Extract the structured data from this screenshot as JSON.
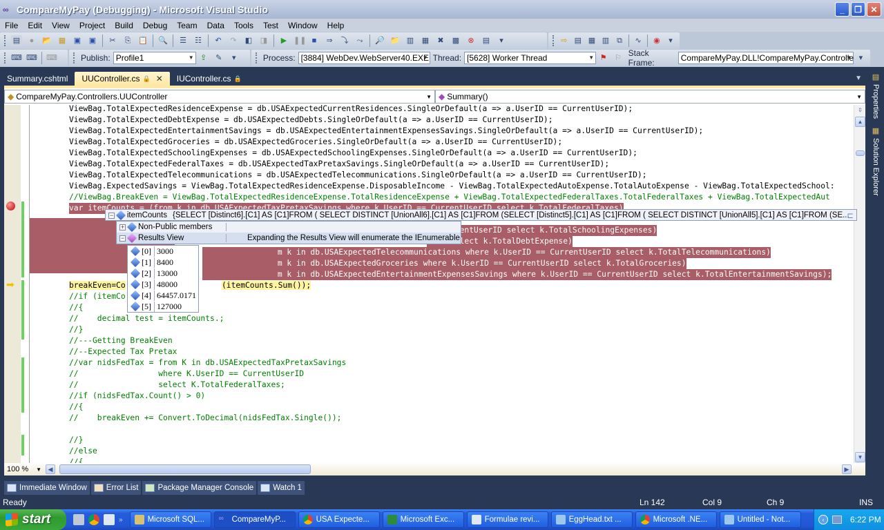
{
  "window": {
    "title": "CompareMyPay (Debugging) - Microsoft Visual Studio"
  },
  "menu": [
    "File",
    "Edit",
    "View",
    "Project",
    "Build",
    "Debug",
    "Team",
    "Data",
    "Tools",
    "Test",
    "Window",
    "Help"
  ],
  "toolbar2": {
    "publish_label": "Publish:",
    "publish_value": "Profile1",
    "process_label": "Process:",
    "process_value": "[3884] WebDev.WebServer40.EXE",
    "thread_label": "Thread:",
    "thread_value": "[5628] Worker Thread",
    "stackframe_label": "Stack Frame:",
    "stackframe_value": "CompareMyPay.DLL!CompareMyPay.Controlle"
  },
  "tabs": [
    {
      "label": "Summary.cshtml",
      "active": false
    },
    {
      "label": "UUController.cs",
      "active": true,
      "locked": true
    },
    {
      "label": "IUController.cs",
      "active": false,
      "locked": true
    }
  ],
  "navbar": {
    "type_value": "CompareMyPay.Controllers.UUController",
    "member_value": "Summary()"
  },
  "code": [
    "ViewBag.TotalExpectedResidenceExpense = db.USAExpectedCurrentResidences.SingleOrDefault(a => a.UserID == CurrentUserID);",
    "ViewBag.TotalExpectedDebtExpense = db.USAExpectedDebts.SingleOrDefault(a => a.UserID == CurrentUserID);",
    "ViewBag.TotalExpectedEntertainmentSavings = db.USAExpectedEntertainmentExpensesSavings.SingleOrDefault(a => a.UserID == CurrentUserID);",
    "ViewBag.TotalExpectedGroceries = db.USAExpectedGroceries.SingleOrDefault(a => a.UserID == CurrentUserID);",
    "ViewBag.TotalExpectedSchoolingExpenses = db.USAExpectedSchoolingExpenses.SingleOrDefault(a => a.UserID == CurrentUserID);",
    "ViewBag.TotalExpectedFederalTaxes = db.USAExpectedTaxPretaxSavings.SingleOrDefault(a => a.UserID == CurrentUserID);",
    "ViewBag.TotalExpectedTelecommunications = db.USAExpectedTelecommunications.SingleOrDefault(a => a.UserID == CurrentUserID);",
    "ViewBag.ExpectedSavings = ViewBag.TotalExpectedResidenceExpense.DisposableIncome - ViewBag.TotalExpectedAutoExpense.TotalAutoExpense - ViewBag.TotalExpectedSchool:",
    "//ViewBag.BreakEven = ViewBag.TotalExpectedResidenceExpense.TotalResidenceExpense + ViewBag.TotalExpectedFederalTaxes.TotalFederalTaxes + ViewBag.TotalExpectedAut",
    "var itemCounts = (from k in db.USAExpectedTaxPretaxSavings where k.UserID == CurrentUserID select k.TotalFederalTaxes)",
    "",
    "                                                              == CurrentUserID select k.TotalSchoolingExpenses)",
    "                                                              erID select k.TotalDebtExpense)",
    "                m k in db.USAExpectedTelecommunications where k.UserID == CurrentUserID select k.TotalTelecommunications)",
    "                m k in db.USAExpectedGroceries where k.UserID == CurrentUserID select k.TotalGroceries)",
    "                m k in db.USAExpectedEntertainmentExpensesSavings where k.UserID == CurrentUserID select k.TotalEntertainmentSavings);",
    "breakEven=Co",
    "//if (itemCo",
    "//{",
    "//    decimal test = itemCounts.;",
    "//}",
    "//---Getting BreakEven",
    "//--Expected Tax Pretax",
    "//var nidsFedTax = from K in db.USAExpectedTaxPretaxSavings",
    "//                 where K.UserID == CurrentUserID",
    "//                 select K.TotalFederalTaxes;",
    "//if (nidsFedTax.Count() > 0)",
    "//{",
    "//    breakEven += Convert.ToDecimal(nidsFedTax.Single());",
    "",
    "//}",
    "//else",
    "//{"
  ],
  "code_tail": {
    "sum_call": "(itemCounts.Sum());"
  },
  "datatip": {
    "name": "itemCounts",
    "value": "{SELECT [Distinct6].[C1] AS [C1]FROM ( SELECT DISTINCT [UnionAll6].[C1] AS [C1]FROM  (SELECT [Distinct5].[C1] AS [C1]FROM ( SELECT DISTINCT [UnionAll5].[C1] AS [C1]FROM  (SE...",
    "non_public": "Non-Public members",
    "results_view": "Results View",
    "results_note": "Expanding the Results View will enumerate the IEnumerable",
    "items": [
      {
        "index": "[0]",
        "value": "3000"
      },
      {
        "index": "[1]",
        "value": "8400"
      },
      {
        "index": "[2]",
        "value": "13000"
      },
      {
        "index": "[3]",
        "value": "48000"
      },
      {
        "index": "[4]",
        "value": "64457.0171"
      },
      {
        "index": "[5]",
        "value": "127000"
      }
    ]
  },
  "editor": {
    "zoom": "100 %"
  },
  "rightrail": [
    "Properties",
    "Solution Explorer"
  ],
  "toolwindows": [
    "Immediate Window",
    "Error List",
    "Package Manager Console",
    "Watch 1"
  ],
  "status": {
    "text": "Ready",
    "ln": "Ln 142",
    "col": "Col 9",
    "ch": "Ch 9",
    "mode": "INS"
  },
  "taskbar": {
    "start": "start",
    "tasks": [
      "Microsoft SQL...",
      "CompareMyP...",
      "USA Expecte...",
      "Microsoft Exc...",
      "Formulae revi...",
      "EggHead.txt ...",
      "Microsoft .NE...",
      "Untitled - Not..."
    ],
    "clock": "6:22 PM"
  }
}
